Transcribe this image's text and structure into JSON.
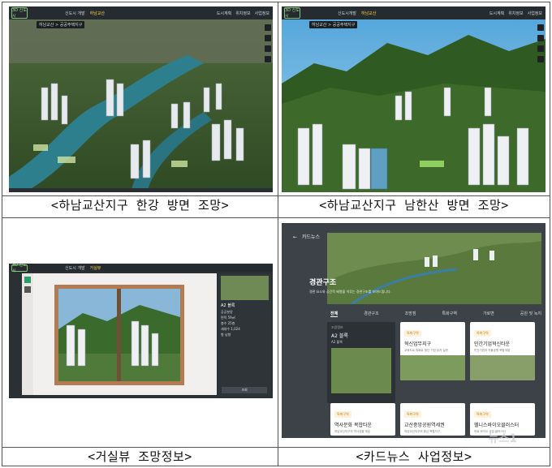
{
  "captions": {
    "top_left": "<하남교산지구 한강 방면 조망>",
    "top_right": "<하남교산지구 남한산 방면 조망>",
    "bottom_left": "<거실뷰 조망정보>",
    "bottom_right": "<카드뉴스 사업정보>"
  },
  "app": {
    "logo_text": "3D 신도시",
    "nav_top_left": [
      "신도시 개발",
      "하남교산",
      "거실뷰"
    ],
    "nav_top_right": [
      "하남교산",
      "신도시개발",
      "하남교산"
    ],
    "nav_right": [
      "도시계획",
      "위치정보",
      "사업정보"
    ],
    "breadcrumb": "하남교산 > 공공주택지구"
  },
  "living_view": {
    "panel_title": "A2 블록",
    "panel_items": [
      "공공분양",
      "면적 59㎡",
      "층수 25층",
      "세대수 1,024",
      "향 남향"
    ],
    "save_button": "조회"
  },
  "card_news": {
    "header": "카드뉴스",
    "hero_title": "경관구조",
    "hero_sub": "경관 요소와 공간적 배열을 이루는 경관구조를 보여드립니다.",
    "tabs": [
      "전체",
      "경관구조",
      "조망점",
      "특화구역",
      "가로변",
      "공원 및 녹지"
    ],
    "active_tab": "전체",
    "left_label": "조망정보",
    "left_title": "A2 블록",
    "left_sub": "A2 블록",
    "cards": [
      {
        "badge": "특화구역",
        "title": "혁신업무지구",
        "sub": "교육도로 특화로 첨단 기업 유치 실현"
      },
      {
        "badge": "특화구역",
        "title": "민간기업혁신타운",
        "sub": "민간기업과 자율공원 복합개발"
      },
      {
        "badge": "특화구역",
        "title": "역사문화 복합타운",
        "sub": "하남교산지구의 역사성을 계승"
      },
      {
        "badge": "특화구역",
        "title": "교산중앙공원역세권",
        "sub": "하남교산지구의 중심 복합지구"
      },
      {
        "badge": "특화구역",
        "title": "헬니스바이오클러스터",
        "sub": "의료 바이오 산업 클러스터"
      }
    ]
  },
  "watermark": "뉴스1"
}
